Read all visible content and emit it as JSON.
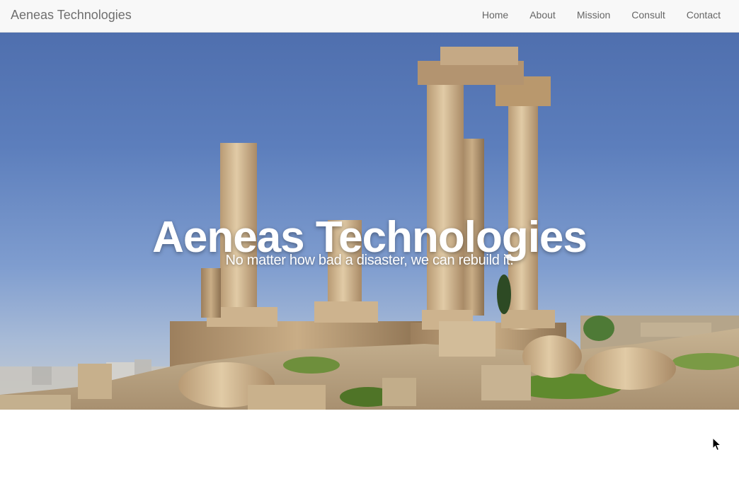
{
  "navbar": {
    "brand": "Aeneas Technologies",
    "links": [
      {
        "label": "Home"
      },
      {
        "label": "About"
      },
      {
        "label": "Mission"
      },
      {
        "label": "Consult"
      },
      {
        "label": "Contact"
      }
    ]
  },
  "hero": {
    "title": "Aeneas Technologies",
    "subtitle": "No matter how bad a disaster, we can rebuild it."
  },
  "icons": {
    "cursor": "mouse-pointer-icon"
  },
  "colors": {
    "navbar_bg": "#f8f8f8",
    "nav_text": "#666666",
    "hero_text": "#ffffff",
    "sky": "#5c7ebc"
  }
}
